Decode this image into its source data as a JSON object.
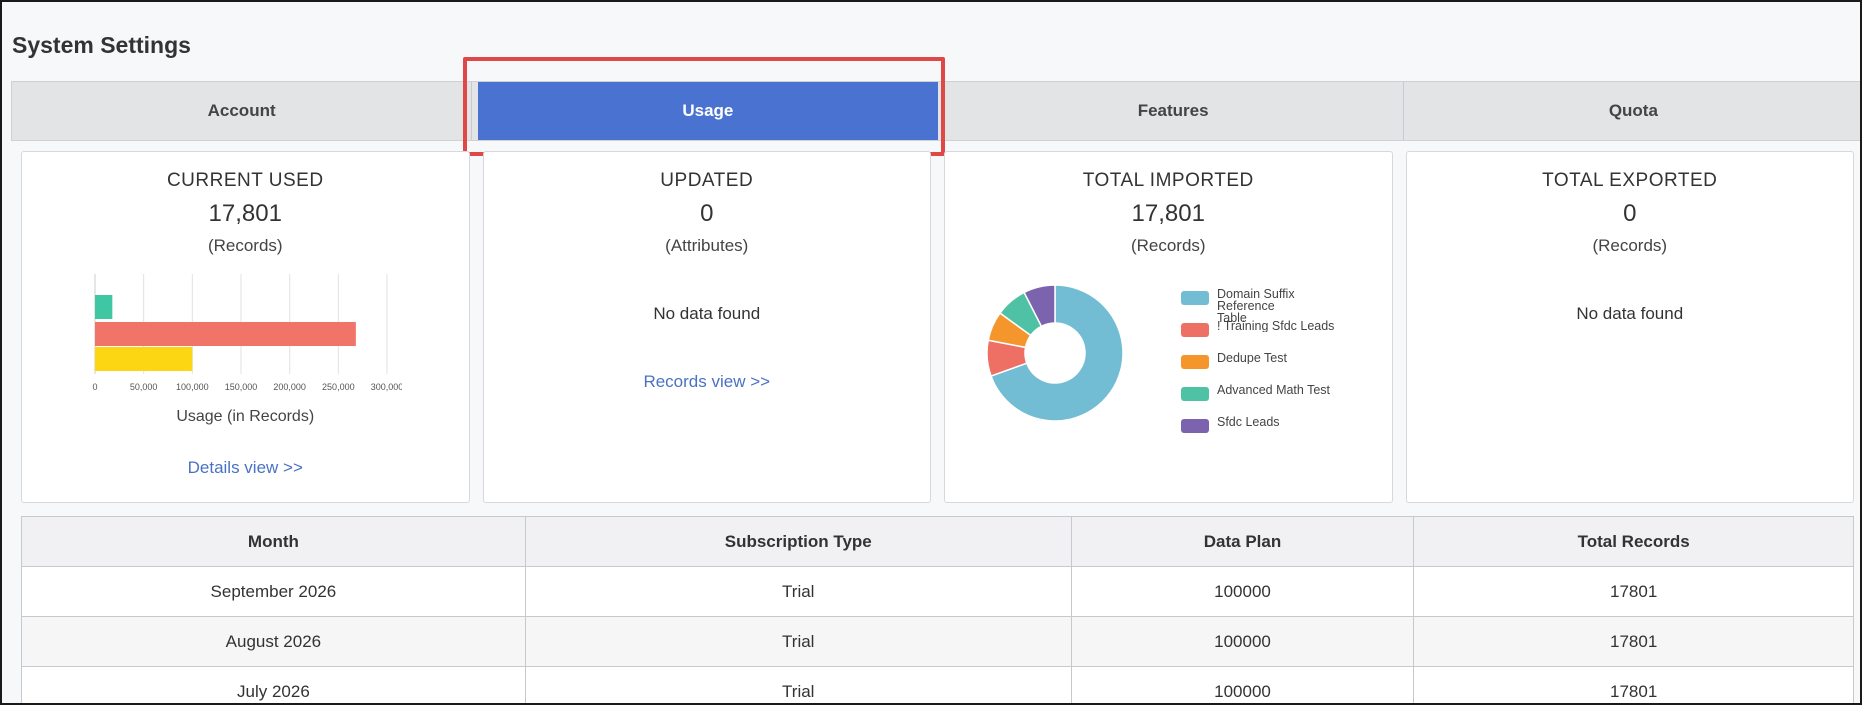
{
  "page": {
    "title": "System Settings"
  },
  "tabs": [
    {
      "label": "Account",
      "active": false
    },
    {
      "label": "Usage",
      "active": true
    },
    {
      "label": "Features",
      "active": false
    },
    {
      "label": "Quota",
      "active": false
    }
  ],
  "cards": {
    "current_used": {
      "title": "CURRENT USED",
      "value": "17,801",
      "unit": "(Records)",
      "link": "Details view >>"
    },
    "updated": {
      "title": "UPDATED",
      "value": "0",
      "unit": "(Attributes)",
      "no_data": "No data found",
      "link": "Records view >>"
    },
    "total_imported": {
      "title": "TOTAL IMPORTED",
      "value": "17,801",
      "unit": "(Records)"
    },
    "total_exported": {
      "title": "TOTAL EXPORTED",
      "value": "0",
      "unit": "(Records)",
      "no_data": "No data found"
    }
  },
  "chart_data": [
    {
      "type": "bar",
      "orientation": "horizontal",
      "xlabel": "Usage (in Records)",
      "xlim": [
        0,
        300000
      ],
      "x_ticks": [
        "0",
        "50,000",
        "100,000",
        "150,000",
        "200,000",
        "250,000",
        "300,000"
      ],
      "grid": true,
      "series": [
        {
          "value": 17801,
          "color": "#3ec7a2"
        },
        {
          "value": 268000,
          "color": "#f07468"
        },
        {
          "value": 100000,
          "color": "#fcd513"
        }
      ]
    },
    {
      "type": "pie",
      "donut": true,
      "legend_position": "right",
      "slices": [
        {
          "label": "Domain Suffix Reference\nTable",
          "value": 69.5,
          "color": "#72bcd4"
        },
        {
          "label": "! Training Sfdc Leads",
          "value": 8.5,
          "color": "#ee7065"
        },
        {
          "label": "Dedupe Test",
          "value": 7.0,
          "color": "#f4962c"
        },
        {
          "label": "Advanced Math Test",
          "value": 7.5,
          "color": "#4fc2a5"
        },
        {
          "label": "Sfdc Leads",
          "value": 7.5,
          "color": "#7b63ad"
        }
      ]
    }
  ],
  "table": {
    "headers": [
      "Month",
      "Subscription Type",
      "Data Plan",
      "Total Records"
    ],
    "rows": [
      [
        "September 2026",
        "Trial",
        "100000",
        "17801"
      ],
      [
        "August 2026",
        "Trial",
        "100000",
        "17801"
      ],
      [
        "July 2026",
        "Trial",
        "100000",
        "17801"
      ]
    ]
  }
}
